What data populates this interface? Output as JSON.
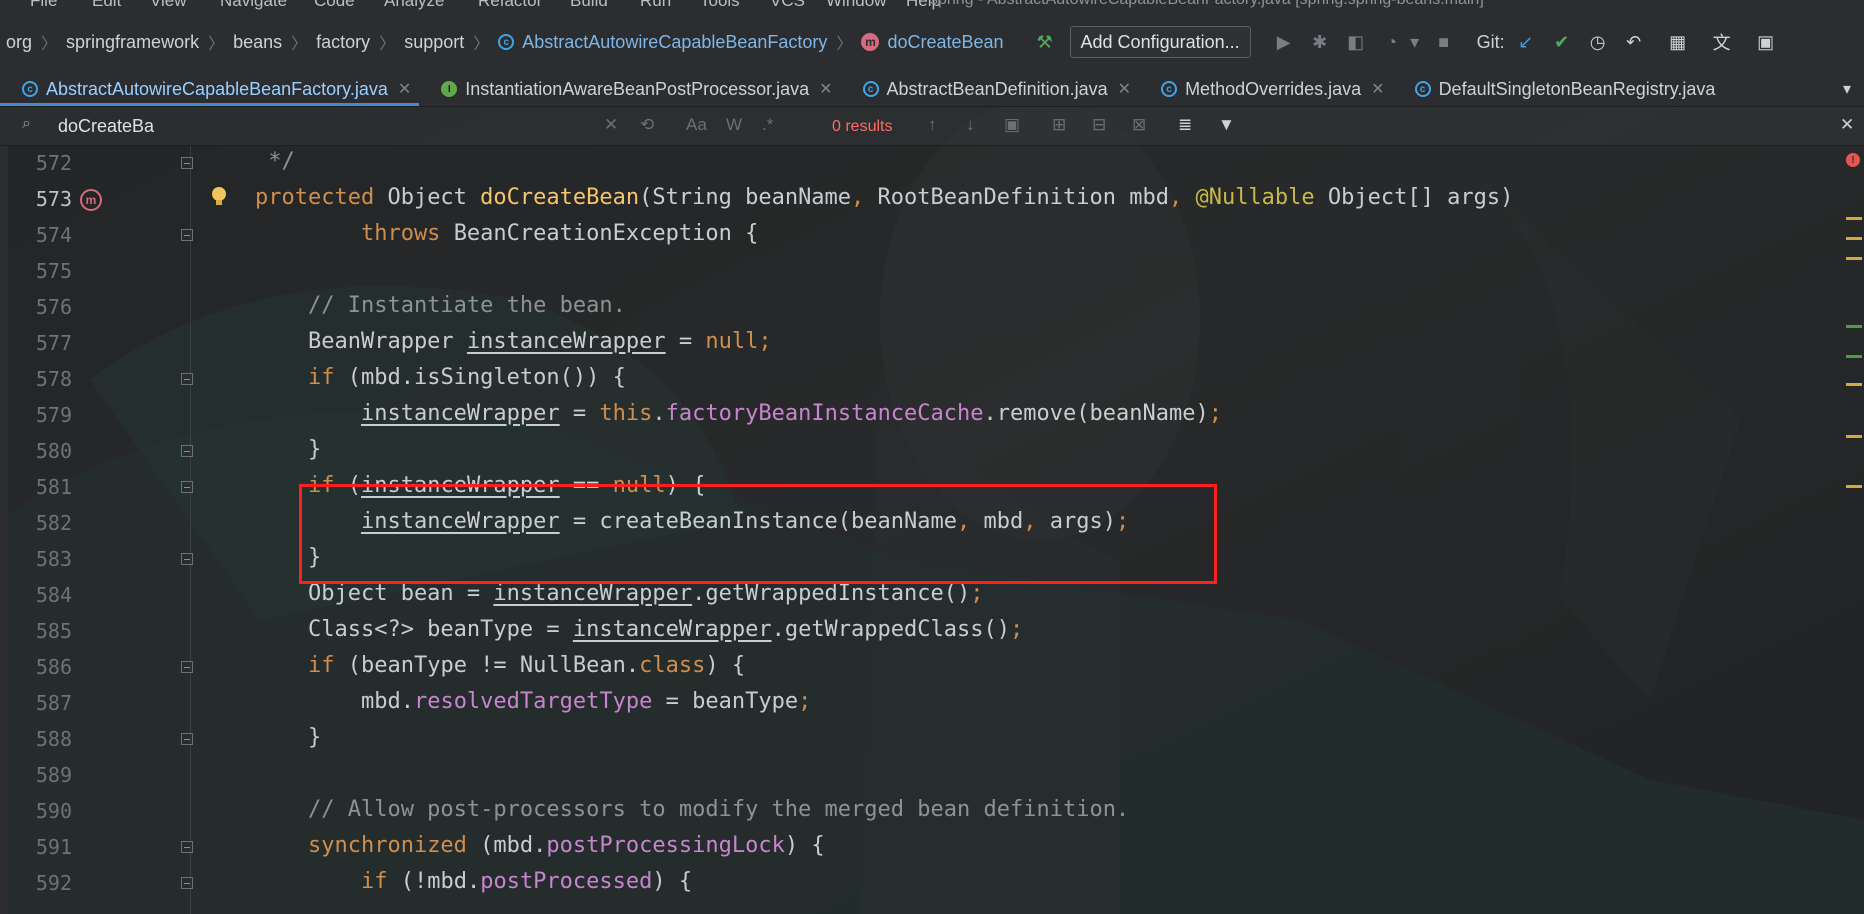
{
  "menu": {
    "items": [
      {
        "label": "File"
      },
      {
        "label": "Edit"
      },
      {
        "label": "View"
      },
      {
        "label": "Navigate"
      },
      {
        "label": "Code"
      },
      {
        "label": "Analyze"
      },
      {
        "label": "Refactor"
      },
      {
        "label": "Build"
      },
      {
        "label": "Run"
      },
      {
        "label": "Tools"
      },
      {
        "label": "VCS"
      },
      {
        "label": "Window"
      },
      {
        "label": "Help"
      }
    ],
    "window_title": "spring - AbstractAutowireCapableBeanFactory.java [spring.spring-beans.main]"
  },
  "breadcrumb": {
    "items": [
      "org",
      "springframework",
      "beans",
      "factory",
      "support",
      "AbstractAutowireCapableBeanFactory",
      "doCreateBean"
    ]
  },
  "toolbar": {
    "add_configuration": "Add Configuration...",
    "git_label": "Git:"
  },
  "tabs": [
    {
      "label": "AbstractAutowireCapableBeanFactory.java",
      "icon": "class-icon",
      "active": true
    },
    {
      "label": "InstantiationAwareBeanPostProcessor.java",
      "icon": "interface-icon",
      "active": false
    },
    {
      "label": "AbstractBeanDefinition.java",
      "icon": "class-icon",
      "active": false
    },
    {
      "label": "MethodOverrides.java",
      "icon": "class-icon",
      "active": false
    },
    {
      "label": "DefaultSingletonBeanRegistry.java",
      "icon": "class-icon",
      "active": false
    }
  ],
  "find": {
    "query": "doCreateBa",
    "results": "0 results",
    "match_case": "Aa",
    "words": "W",
    "regex": ".*"
  },
  "editor": {
    "lines": [
      {
        "n": "572",
        "text": " */"
      },
      {
        "n": "573",
        "text": "protected Object doCreateBean(String beanName, RootBeanDefinition mbd, @Nullable Object[] args)"
      },
      {
        "n": "574",
        "text": "        throws BeanCreationException {"
      },
      {
        "n": "575",
        "text": ""
      },
      {
        "n": "576",
        "text": "    // Instantiate the bean."
      },
      {
        "n": "577",
        "text": "    BeanWrapper instanceWrapper = null;"
      },
      {
        "n": "578",
        "text": "    if (mbd.isSingleton()) {"
      },
      {
        "n": "579",
        "text": "        instanceWrapper = this.factoryBeanInstanceCache.remove(beanName);"
      },
      {
        "n": "580",
        "text": "    }"
      },
      {
        "n": "581",
        "text": "    if (instanceWrapper == null) {"
      },
      {
        "n": "582",
        "text": "        instanceWrapper = createBeanInstance(beanName, mbd, args);"
      },
      {
        "n": "583",
        "text": "    }"
      },
      {
        "n": "584",
        "text": "    Object bean = instanceWrapper.getWrappedInstance();"
      },
      {
        "n": "585",
        "text": "    Class<?> beanType = instanceWrapper.getWrappedClass();"
      },
      {
        "n": "586",
        "text": "    if (beanType != NullBean.class) {"
      },
      {
        "n": "587",
        "text": "        mbd.resolvedTargetType = beanType;"
      },
      {
        "n": "588",
        "text": "    }"
      },
      {
        "n": "589",
        "text": ""
      },
      {
        "n": "590",
        "text": "    // Allow post-processors to modify the merged bean definition."
      },
      {
        "n": "591",
        "text": "    synchronized (mbd.postProcessingLock) {"
      },
      {
        "n": "592",
        "text": "        if (!mbd.postProcessed) {"
      }
    ]
  },
  "colors": {
    "keyword": "#d08d4d",
    "method": "#f6c56b",
    "annotation": "#c9b84a",
    "field": "#c984cf",
    "highlight": "#ff1f1f",
    "no_results": "#ff6b68"
  }
}
